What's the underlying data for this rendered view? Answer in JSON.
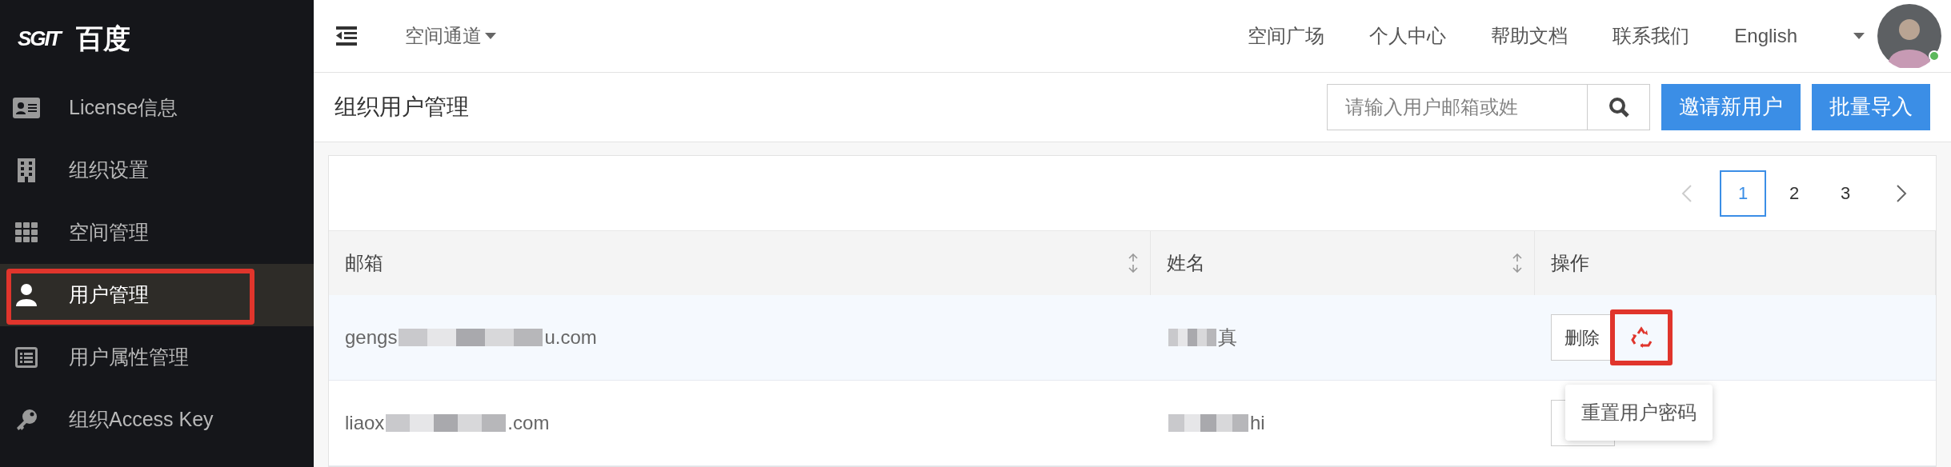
{
  "sidebar": {
    "logo": "SGIT",
    "title": "百度",
    "items": [
      {
        "label": "License信息",
        "selected": false,
        "highlighted": false
      },
      {
        "label": "组织设置",
        "selected": false,
        "highlighted": false
      },
      {
        "label": "空间管理",
        "selected": false,
        "highlighted": false
      },
      {
        "label": "用户管理",
        "selected": true,
        "highlighted": true
      },
      {
        "label": "用户属性管理",
        "selected": false,
        "highlighted": false
      },
      {
        "label": "组织Access Key",
        "selected": false,
        "highlighted": false
      }
    ]
  },
  "topbar": {
    "space_menu": "空间通道",
    "links": [
      "空间广场",
      "个人中心",
      "帮助文档",
      "联系我们"
    ],
    "language": "English",
    "user": {
      "online": true
    }
  },
  "page": {
    "title": "组织用户管理",
    "search": {
      "placeholder": "请输入用户邮箱或姓"
    },
    "buttons": [
      "邀请新用户",
      "批量导入"
    ]
  },
  "pagination": {
    "pages": [
      {
        "label": "1",
        "selected": true
      },
      {
        "label": "2",
        "selected": false
      },
      {
        "label": "3",
        "selected": false
      }
    ]
  },
  "table": {
    "columns": [
      {
        "label": "邮箱",
        "sortable": true
      },
      {
        "label": "姓名",
        "sortable": true
      },
      {
        "label": "操作",
        "sortable": false
      }
    ],
    "rows": [
      {
        "email_start": "gengs",
        "email_end": "u.com",
        "name_end": "真",
        "delete": "删除",
        "hovered": true,
        "reset_highlighted": true
      },
      {
        "email_start": "liaox",
        "email_end": ".com",
        "name_end": "hi",
        "hovered": false,
        "reset_highlighted": false
      }
    ]
  },
  "tooltip": {
    "text": "重置用户密码"
  }
}
